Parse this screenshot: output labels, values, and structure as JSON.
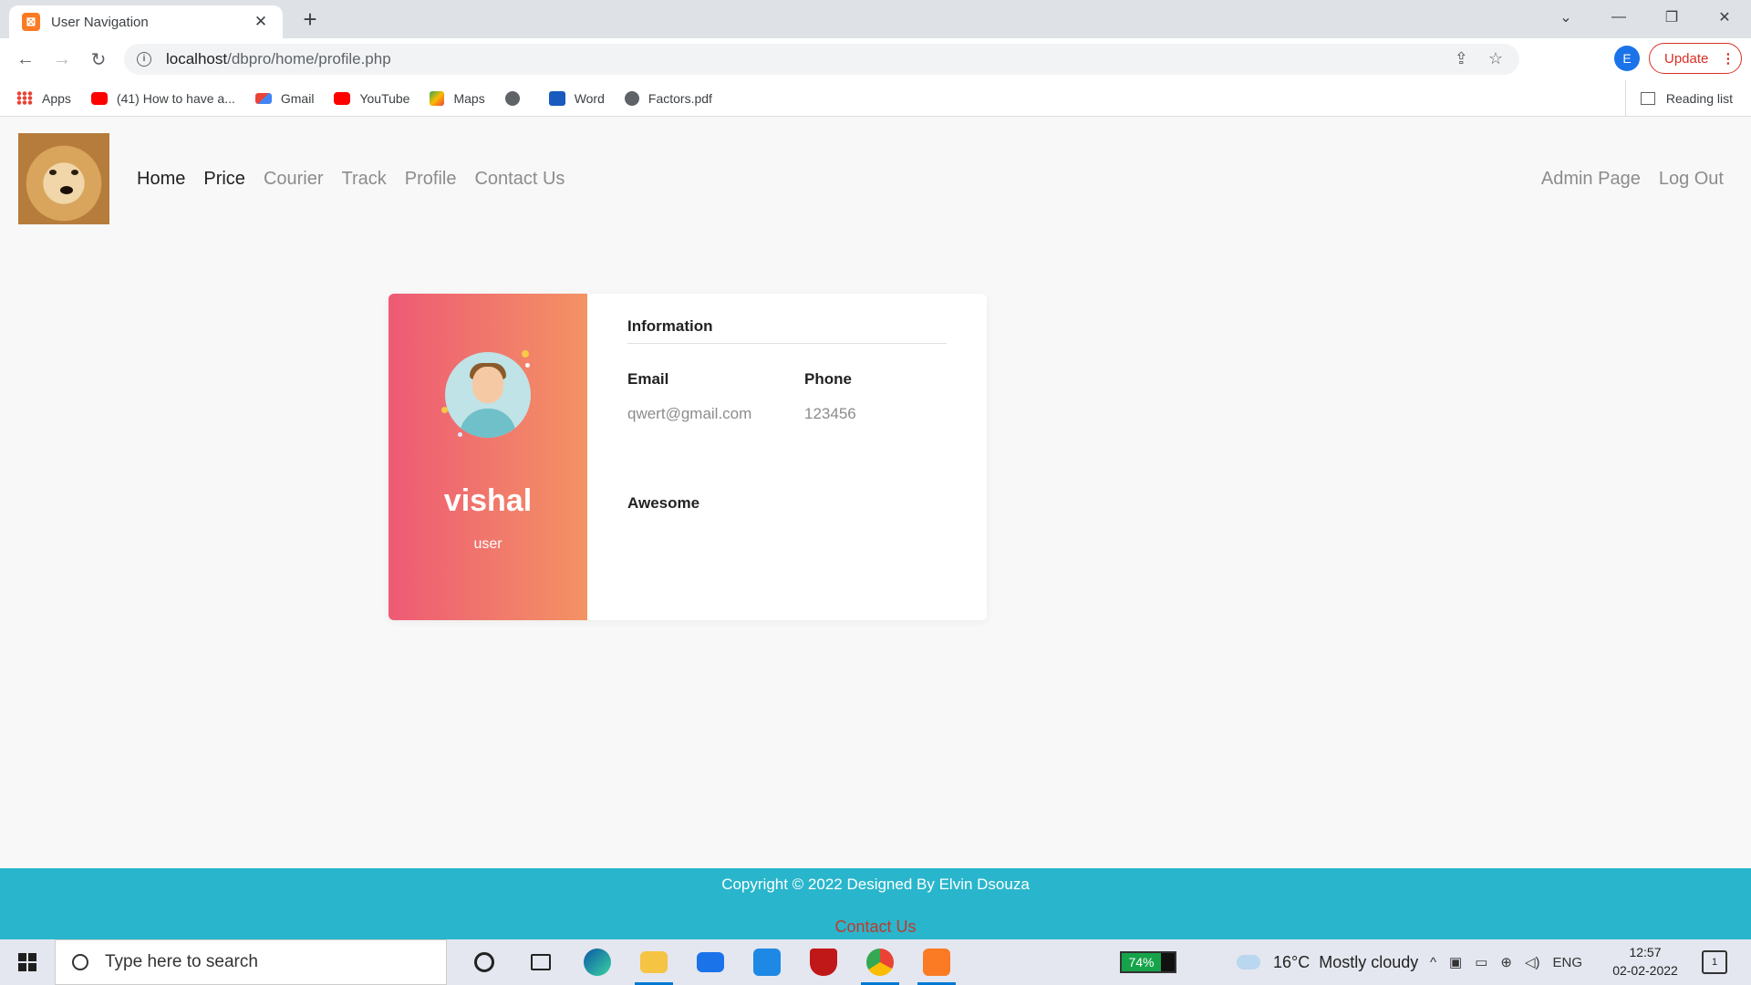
{
  "browser": {
    "tab_title": "User Navigation",
    "new_tab": "+",
    "url_host": "localhost",
    "url_path": "/dbpro/home/profile.php",
    "profile_initial": "E",
    "update_label": "Update",
    "bookmarks": [
      {
        "label": "Apps",
        "icon": "apps-grid-icon"
      },
      {
        "label": "(41) How to have a...",
        "icon": "youtube-icon"
      },
      {
        "label": "Gmail",
        "icon": "gmail-icon"
      },
      {
        "label": "YouTube",
        "icon": "youtube-icon"
      },
      {
        "label": "Maps",
        "icon": "maps-icon"
      },
      {
        "label": "",
        "icon": "globe-icon"
      },
      {
        "label": "Word",
        "icon": "word-icon"
      },
      {
        "label": "Factors.pdf",
        "icon": "globe-icon"
      }
    ],
    "reading_list": "Reading list"
  },
  "site": {
    "nav": {
      "home": "Home",
      "price": "Price",
      "courier": "Courier",
      "track": "Track",
      "profile": "Profile",
      "contact": "Contact Us",
      "admin": "Admin Page",
      "logout": "Log Out"
    },
    "profile": {
      "name": "vishal",
      "role": "user",
      "info_title": "Information",
      "email_label": "Email",
      "email_value": "qwert@gmail.com",
      "phone_label": "Phone",
      "phone_value": "123456",
      "extra": "Awesome"
    },
    "footer": {
      "copyright": "Copyright © 2022 Designed By Elvin Dsouza",
      "contact": "Contact Us"
    },
    "colors": {
      "card_gradient_start": "#ee5a75",
      "card_gradient_end": "#f39363",
      "footer_bg": "#29b6cc",
      "footer_link": "#c0392b"
    }
  },
  "taskbar": {
    "search_placeholder": "Type here to search",
    "battery": "74%",
    "battery_level": 0.74,
    "temperature": "16°C",
    "weather": "Mostly cloudy",
    "language": "ENG",
    "time": "12:57",
    "date": "02-02-2022",
    "notifications": "1"
  }
}
